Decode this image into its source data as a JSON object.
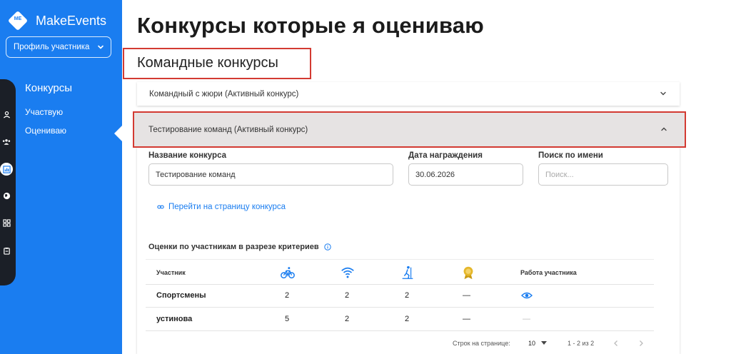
{
  "app": {
    "logo_text": "ME",
    "name": "MakeEvents"
  },
  "sidebar": {
    "profile_label": "Профиль участника",
    "nav_title": "Конкурсы",
    "items": [
      {
        "label": "Участвую"
      },
      {
        "label": "Оцениваю",
        "active": true
      }
    ],
    "rail_icons": [
      "user-icon",
      "group-icon",
      "chart-icon",
      "globe-icon",
      "grid-icon",
      "clipboard-icon"
    ]
  },
  "main": {
    "page_title": "Конкурсы которые я оцениваю",
    "section_title": "Командные конкурсы",
    "accordions": [
      {
        "title": "Командный с жюри (Активный конкурс)",
        "expanded": false
      },
      {
        "title": "Тестирование команд (Активный конкурс)",
        "expanded": true
      }
    ],
    "form": {
      "name_label": "Название конкурса",
      "name_value": "Тестирование команд",
      "date_label": "Дата награждения",
      "date_value": "30.06.2026",
      "search_label": "Поиск по имени",
      "search_placeholder": "Поиск..."
    },
    "link_label": "Перейти на страницу конкурса",
    "scores_title": "Оценки по участникам в разрезе критериев",
    "table": {
      "col_participant": "Участник",
      "criteria_icons": [
        "bicycle-icon",
        "wifi-icon",
        "skiing-icon",
        "award-icon"
      ],
      "col_work": "Работа участника",
      "rows": [
        {
          "name": "Спортсмены",
          "scores": [
            "2",
            "2",
            "2",
            "—"
          ],
          "work": "eye-icon"
        },
        {
          "name": "устинова",
          "scores": [
            "5",
            "2",
            "2",
            "—"
          ],
          "work": "—"
        }
      ]
    },
    "pagination": {
      "rows_label": "Строк на странице:",
      "rows_value": "10",
      "range": "1 - 2 из 2"
    }
  },
  "colors": {
    "sidebar": "#1a7df0",
    "accent": "#1a7df0",
    "highlight": "#d33a32",
    "rail": "#1b1f27"
  }
}
